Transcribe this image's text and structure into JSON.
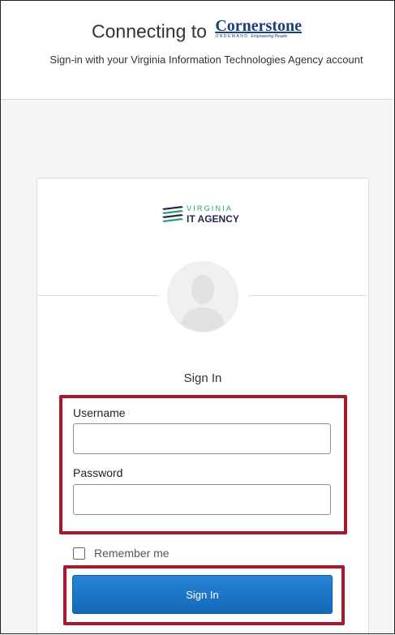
{
  "header": {
    "connecting_text": "Connecting to",
    "brand_name": "Cornerstone",
    "brand_sub": "ONDEMAND",
    "brand_tagline": "Empowering People",
    "description": "Sign-in with your Virginia Information Technologies Agency account"
  },
  "logo": {
    "line1": "VIRGINIA",
    "line2": "IT AGENCY"
  },
  "form": {
    "title": "Sign In",
    "username_label": "Username",
    "username_value": "",
    "password_label": "Password",
    "password_value": "",
    "remember_label": "Remember me",
    "remember_checked": false,
    "submit_label": "Sign In"
  },
  "colors": {
    "highlight": "#a8182c",
    "button": "#1a78c9",
    "brand": "#1a3f7a",
    "logo_green": "#2b9e6e"
  }
}
